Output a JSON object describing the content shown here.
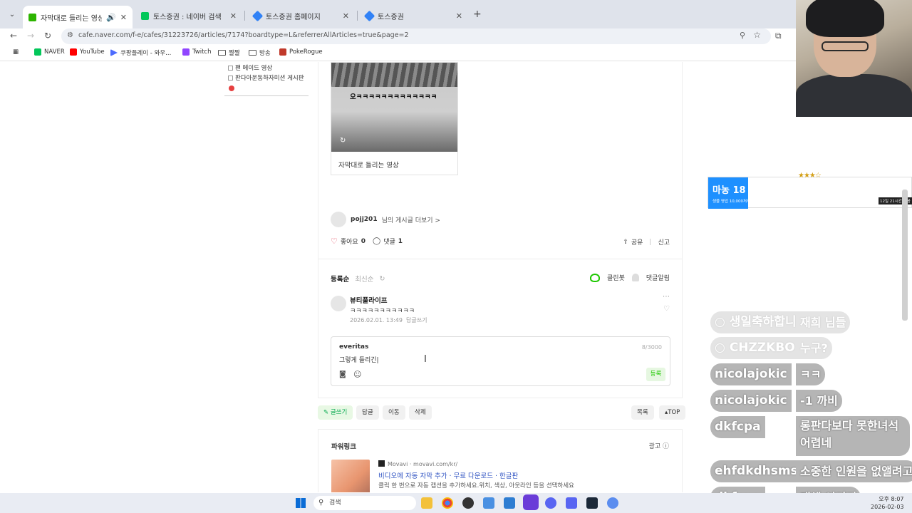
{
  "browser": {
    "tabs": [
      {
        "label": "자막대로 들리는 영상 : 네이",
        "color": "#2db400"
      },
      {
        "label": "토스증권 : 네이버 검색",
        "color": "#03c75a"
      },
      {
        "label": "토스증권 홈페이지",
        "color": "#3182f6"
      },
      {
        "label": "토스증권",
        "color": "#3182f6"
      }
    ],
    "url": "cafe.naver.com/f-e/cafes/31223726/articles/7174?boardtype=L&referrerAllArticles=true&page=2",
    "bookmarks": [
      {
        "label": "NAVER",
        "icon": "naver-icon",
        "color": "#03c75a"
      },
      {
        "label": "YouTube",
        "icon": "youtube-icon",
        "color": "#ff0000"
      },
      {
        "label": "쿠팡플레이 - 와우...",
        "icon": "coupang-play-icon",
        "color": "#4d6bfe"
      },
      {
        "label": "Twitch",
        "icon": "twitch-icon",
        "color": "#9146ff"
      },
      {
        "label": "짤짤",
        "icon": "folder-icon",
        "color": ""
      },
      {
        "label": "방송",
        "icon": "folder-icon",
        "color": ""
      },
      {
        "label": "PokeRogue",
        "icon": "pokerogue-icon",
        "color": "#c0392b"
      }
    ]
  },
  "sidebar": {
    "items": [
      "팬 메이드 영상",
      "판다아운동하자미션 게시판"
    ]
  },
  "article": {
    "video_caption": "오ㅋㅋㅋㅋㅋㅋㅋㅋㅋㅋㅋㅋㅋ",
    "video_title": "자막대로 들리는 영상",
    "author": "pojj201",
    "author_more": "님의 게시글 더보기 >",
    "like_label": "좋아요",
    "like_count": "0",
    "comment_label": "댓글",
    "comment_count": "1",
    "share_label": "공유",
    "report_label": "신고"
  },
  "comments": {
    "sort_registered": "등록순",
    "sort_latest": "최신순",
    "cleanbot": "클린봇",
    "notify": "댓글알림",
    "items": [
      {
        "author": "뷰티풀라이프",
        "text": "ㅋㅋㅋㅋㅋㅋㅋㅋㅋㅋㅋ",
        "date": "2026.02.01. 13:49",
        "reply": "답글쓰기"
      }
    ]
  },
  "compose": {
    "author": "everitas",
    "count": "8/3000",
    "text": "그렇게 들리긴|",
    "submit": "등록"
  },
  "actions": {
    "write": "글쓰기",
    "reply": "답글",
    "move": "이동",
    "delete": "삭제",
    "list": "목록",
    "top": "TOP"
  },
  "ad": {
    "title": "파워링크",
    "label": "광고",
    "source": "Movavi · movavi.com/kr/",
    "headline": "비디오에 자동 자막 추가 · 무료 다운로드 · 한글판",
    "desc": "클릭 한 번으로 자동 캡션을 추가하세요.위치, 색상, 아웃라인 등을 선택하세요"
  },
  "taskbar": {
    "search": "검색",
    "time": "오후 8:07",
    "date": "2026-02-03"
  },
  "stream": {
    "donation_main": "마농 18",
    "donation_sub": "생물 영업 10,000처사",
    "donation_tag": "12일 21시간 남음",
    "stars": "★★★☆",
    "chat": [
      {
        "name": "○ 생일축하합니다",
        "msg": "재희 님들",
        "faded": true
      },
      {
        "name": "○ CHZZKBO",
        "msg": "누구?",
        "faded": true
      },
      {
        "name": "nicolajokic",
        "msg": "ㅋㅋ",
        "faded": false
      },
      {
        "name": "nicolajokic",
        "msg": "-1 까비",
        "faded": false
      },
      {
        "name": "dkfcpa",
        "msg": "롱판다보다 못한녀석 어렵네",
        "faded": false
      },
      {
        "name": "ehfdkdhsms",
        "msg": "소중한 인원을 없앨려고",
        "faded": false
      },
      {
        "name": "dkfcpa",
        "msg": "대체 어디지",
        "faded": false
      }
    ]
  }
}
